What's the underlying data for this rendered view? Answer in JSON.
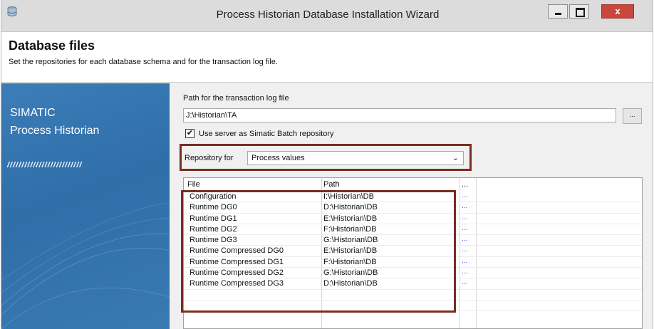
{
  "window": {
    "title": "Process Historian Database Installation Wizard",
    "controls": {
      "minimize": "minimize-icon",
      "maximize": "maximize-icon",
      "close": "x"
    }
  },
  "header": {
    "title": "Database files",
    "subtitle": "Set the repositories for each database schema and for the transaction log file."
  },
  "brand": {
    "line1": "SIMATIC",
    "line2": "Process Historian",
    "stripes": "//////////////////////////"
  },
  "form": {
    "log_path_label": "Path for the transaction log file",
    "log_path_value": "J:\\Historian\\TA",
    "browse_label": "...",
    "checkbox_label": "Use server as Simatic Batch repository",
    "checkbox_checked": true,
    "repository_label": "Repository for",
    "repository_value": "Process values"
  },
  "grid": {
    "columns": [
      "File",
      "Path",
      "..."
    ],
    "rows": [
      {
        "file": "Configuration",
        "path": "I:\\Historian\\DB",
        "action": "..."
      },
      {
        "file": "Runtime DG0",
        "path": "D:\\Historian\\DB",
        "action": "..."
      },
      {
        "file": "Runtime DG1",
        "path": "E:\\Historian\\DB",
        "action": "..."
      },
      {
        "file": "Runtime DG2",
        "path": "F:\\Historian\\DB",
        "action": "..."
      },
      {
        "file": "Runtime DG3",
        "path": "G:\\Historian\\DB",
        "action": "..."
      },
      {
        "file": "Runtime Compressed DG0",
        "path": "E:\\Historian\\DB",
        "action": "..."
      },
      {
        "file": "Runtime Compressed DG1",
        "path": "F:\\Historian\\DB",
        "action": "..."
      },
      {
        "file": "Runtime Compressed DG2",
        "path": "G:\\Historian\\DB",
        "action": "..."
      },
      {
        "file": "Runtime Compressed DG3",
        "path": "D:\\Historian\\DB",
        "action": "..."
      }
    ]
  },
  "colors": {
    "brand_panel": "#3a7ab3",
    "highlight": "#7a2c23",
    "close_button": "#c9463d",
    "link": "#2255cc"
  }
}
